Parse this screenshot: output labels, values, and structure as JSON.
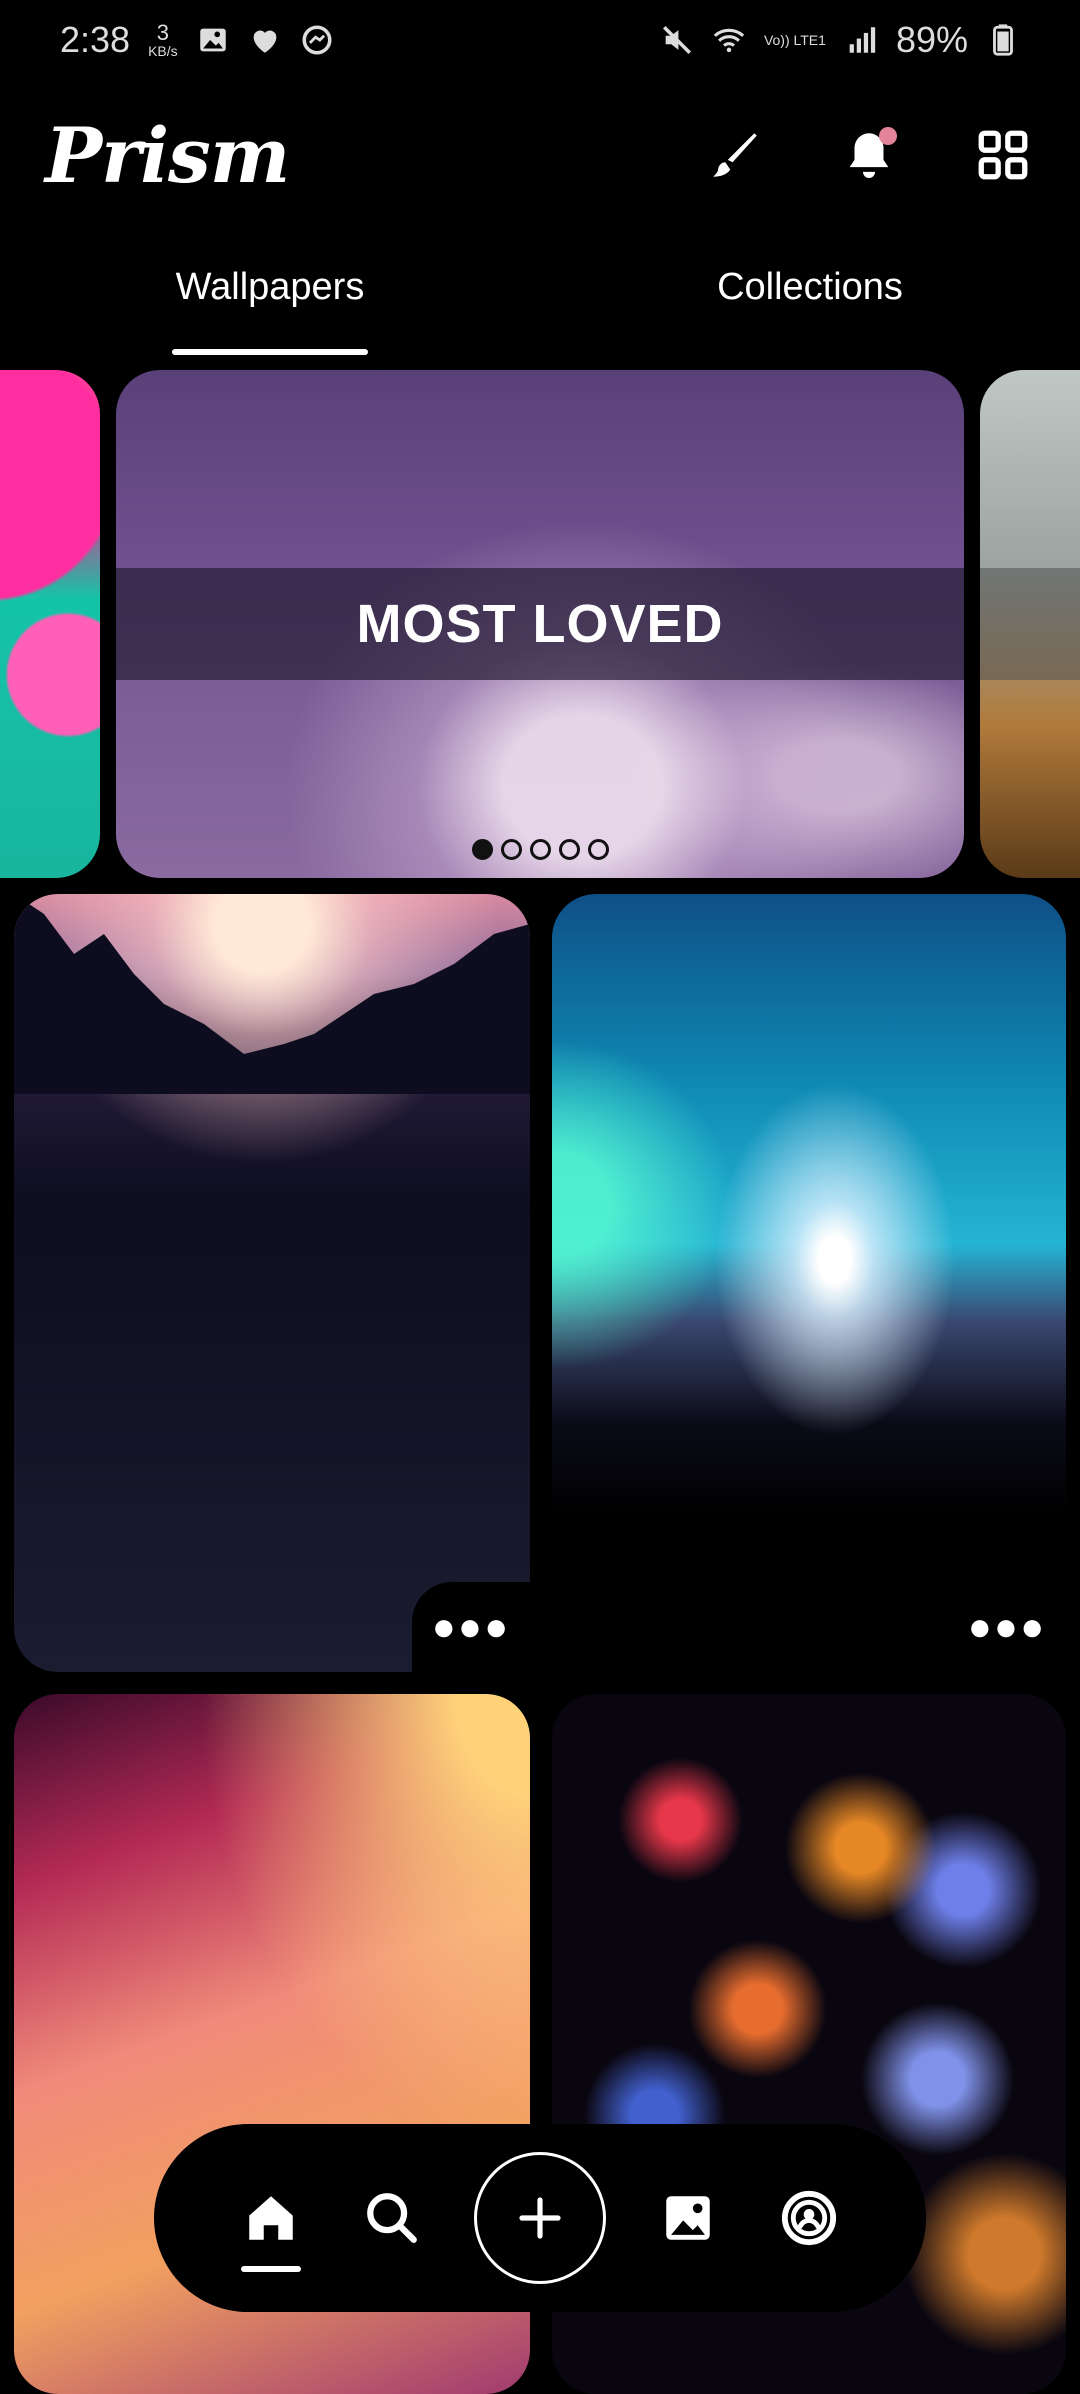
{
  "status_bar": {
    "time": "2:38",
    "speed_value": "3",
    "speed_unit": "KB/s",
    "battery": "89%",
    "icons": [
      "image-icon",
      "heart-icon",
      "messenger-icon",
      "mute-icon",
      "wifi-icon",
      "volte-icon",
      "signal-icon",
      "battery-icon"
    ],
    "volte_label": "Vo)) LTE1"
  },
  "header": {
    "brand": "Prism",
    "actions": [
      "brush-icon",
      "bell-icon",
      "grid-icon"
    ],
    "notification_dot_color": "#e58399"
  },
  "tabs": [
    {
      "label": "Wallpapers",
      "active": true
    },
    {
      "label": "Collections",
      "active": false
    }
  ],
  "carousel": {
    "banner_text": "MOST LOVED",
    "slide_count": 5,
    "active_index": 0
  },
  "grid": {
    "more_label": "●●●"
  },
  "bottom_nav": {
    "items": [
      "home-icon",
      "search-icon",
      "add-icon",
      "image-icon",
      "profile-icon"
    ],
    "active": "home-icon"
  }
}
